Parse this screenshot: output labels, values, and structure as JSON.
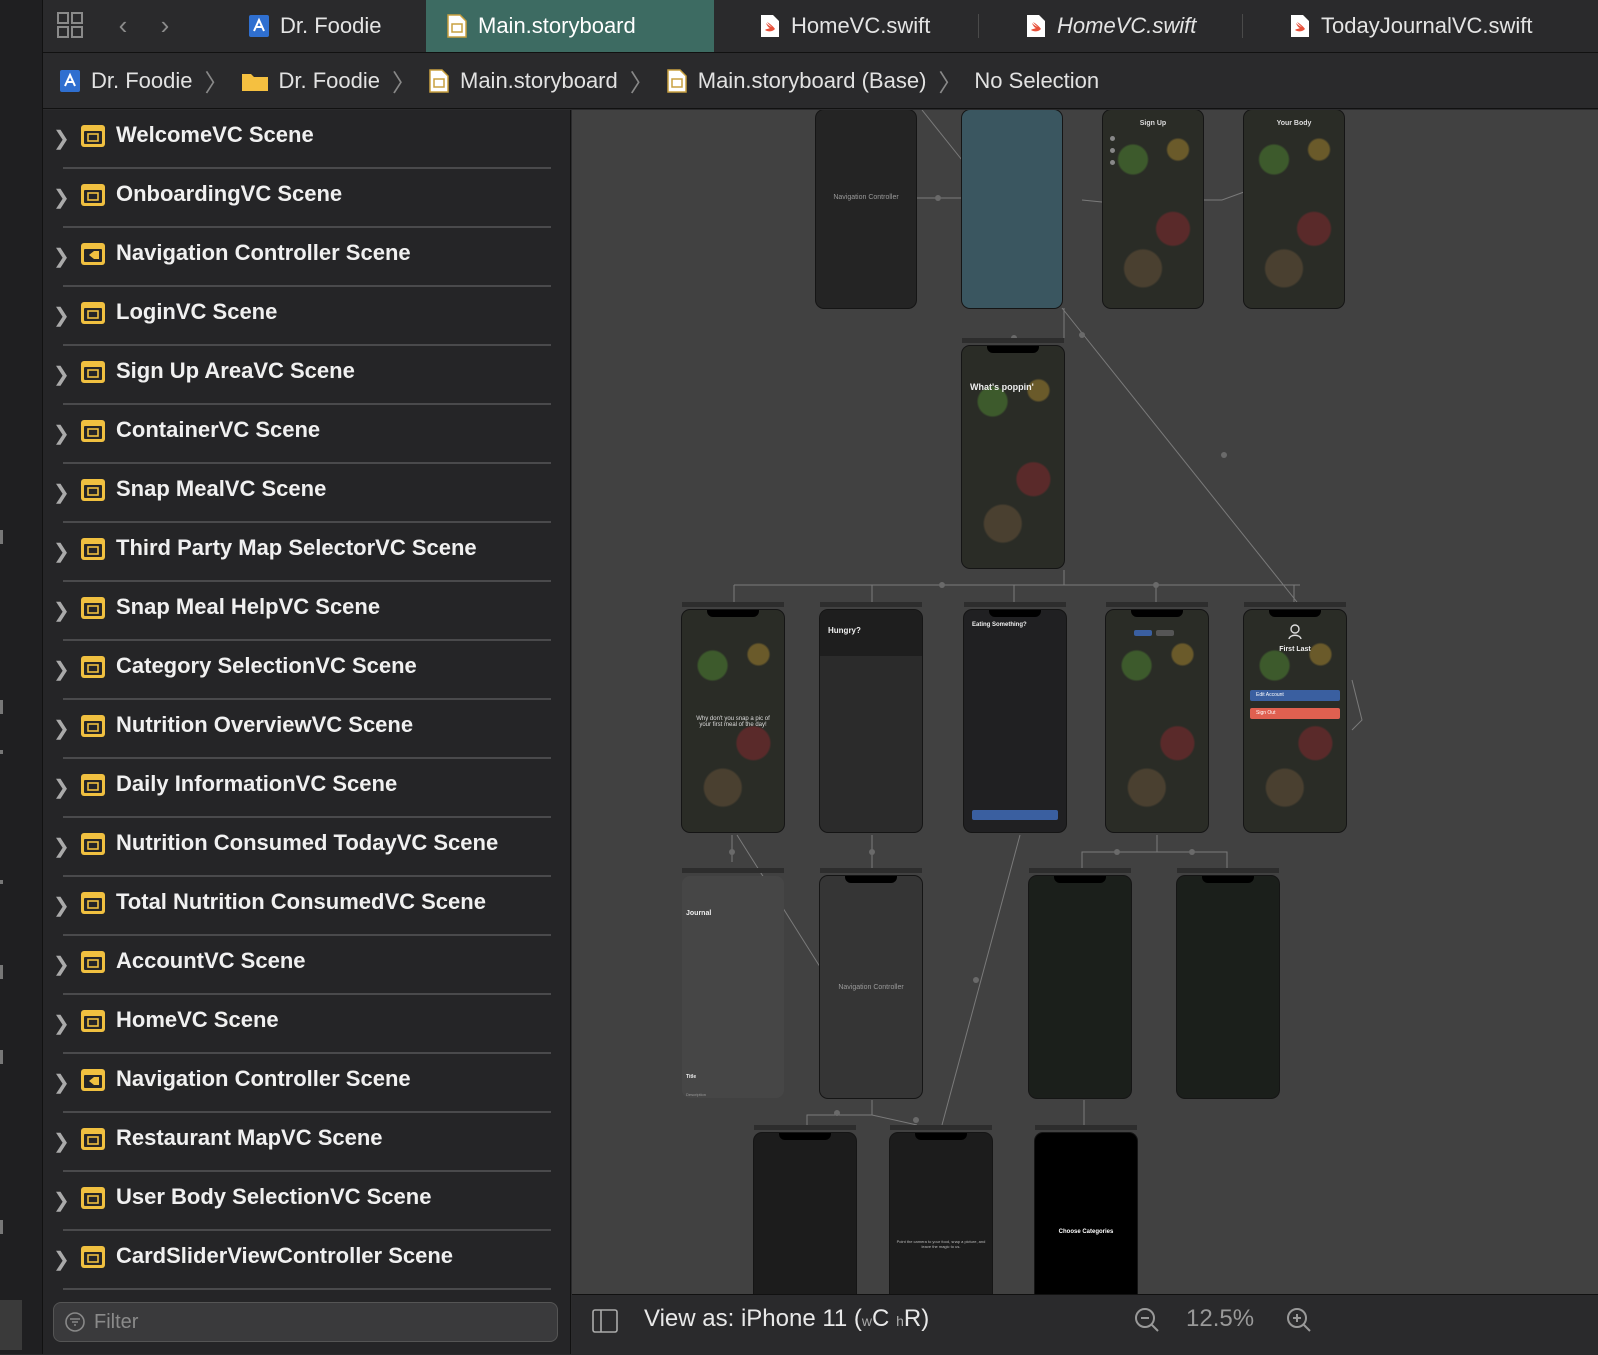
{
  "tabs": [
    {
      "label": "Dr. Foodie",
      "icon": "project-icon",
      "active": false,
      "italic": false
    },
    {
      "label": "Main.storyboard",
      "icon": "storyboard-file-icon",
      "active": true,
      "italic": false
    },
    {
      "label": "HomeVC.swift",
      "icon": "swift-file-icon",
      "active": false,
      "italic": false
    },
    {
      "label": "HomeVC.swift",
      "icon": "swift-file-icon",
      "active": false,
      "italic": true
    },
    {
      "label": "TodayJournalVC.swift",
      "icon": "swift-file-icon",
      "active": false,
      "italic": false
    }
  ],
  "breadcrumb": [
    {
      "label": "Dr. Foodie",
      "icon": "project-icon"
    },
    {
      "label": "Dr. Foodie",
      "icon": "folder-icon"
    },
    {
      "label": "Main.storyboard",
      "icon": "storyboard-file-icon"
    },
    {
      "label": "Main.storyboard (Base)",
      "icon": "storyboard-file-icon"
    },
    {
      "label": "No Selection",
      "icon": ""
    }
  ],
  "scenes": [
    {
      "label": "WelcomeVC Scene",
      "icon": "scene-icon"
    },
    {
      "label": "OnboardingVC Scene",
      "icon": "scene-icon"
    },
    {
      "label": "Navigation Controller Scene",
      "icon": "nav-controller-scene-icon"
    },
    {
      "label": "LoginVC Scene",
      "icon": "scene-icon"
    },
    {
      "label": "Sign Up AreaVC Scene",
      "icon": "scene-icon"
    },
    {
      "label": "ContainerVC Scene",
      "icon": "scene-icon"
    },
    {
      "label": "Snap MealVC Scene",
      "icon": "scene-icon"
    },
    {
      "label": "Third Party Map SelectorVC Scene",
      "icon": "scene-icon"
    },
    {
      "label": "Snap Meal HelpVC Scene",
      "icon": "scene-icon"
    },
    {
      "label": "Category SelectionVC Scene",
      "icon": "scene-icon"
    },
    {
      "label": "Nutrition OverviewVC Scene",
      "icon": "scene-icon"
    },
    {
      "label": "Daily InformationVC Scene",
      "icon": "scene-icon"
    },
    {
      "label": "Nutrition Consumed TodayVC Scene",
      "icon": "scene-icon"
    },
    {
      "label": "Total Nutrition ConsumedVC Scene",
      "icon": "scene-icon"
    },
    {
      "label": "AccountVC Scene",
      "icon": "scene-icon"
    },
    {
      "label": "HomeVC Scene",
      "icon": "scene-icon"
    },
    {
      "label": "Navigation Controller Scene",
      "icon": "nav-controller-scene-icon"
    },
    {
      "label": "Restaurant MapVC Scene",
      "icon": "scene-icon"
    },
    {
      "label": "User Body SelectionVC Scene",
      "icon": "scene-icon"
    },
    {
      "label": "CardSliderViewController Scene",
      "icon": "scene-icon"
    }
  ],
  "filter": {
    "placeholder": "Filter"
  },
  "canvas": {
    "nav_controller_1": "Navigation Controller",
    "sign_up": "Sign Up",
    "your_body": "Your Body",
    "whats_poppin": "What's poppin'",
    "hungry": "Hungry?",
    "eating_something": "Eating Something?",
    "first_last": "First Last",
    "edit_account": "Edit Account",
    "sign_out": "Sign Out",
    "snap_text": "Why don't you snap a pic of your first meal of the day!",
    "journal": "Journal",
    "journal_title": "Title",
    "journal_desc": "Description",
    "nav_controller_2": "Navigation Controller",
    "choose_categories": "Choose Categories",
    "camera_text": "Point the camera to your food, snap a picture, and leave the magic to us."
  },
  "bottom": {
    "view_as_prefix": "View as: iPhone 11 (",
    "w": "w",
    "c": "C",
    "h": "h",
    "r": "R",
    "view_as_suffix": ")",
    "zoom": "12.5%"
  },
  "colors": {
    "active_tab": "#3d6b62",
    "scene_icon": "#f0c040",
    "canvas_bg": "#414141",
    "sign_out": "#e06050",
    "edit_account": "#3a5fa0"
  }
}
